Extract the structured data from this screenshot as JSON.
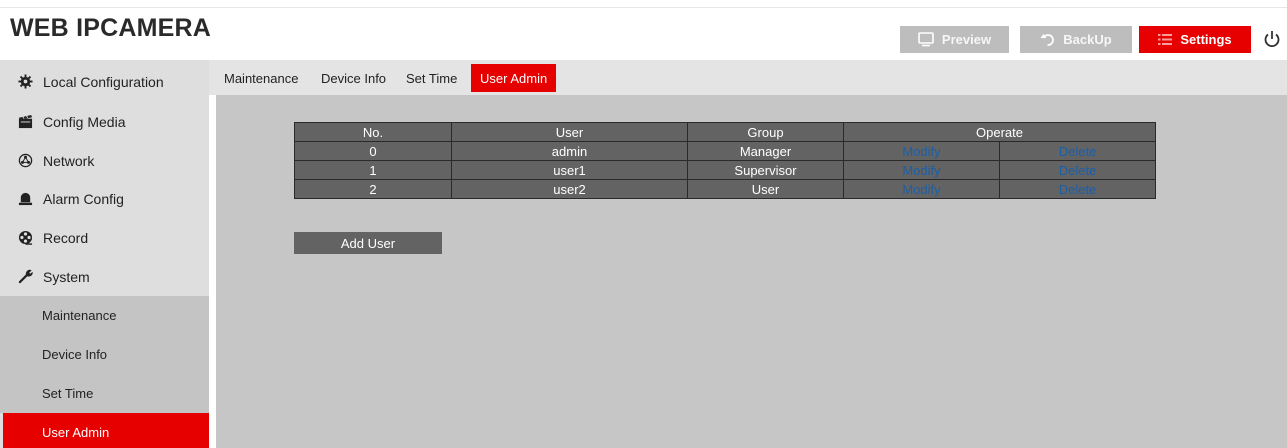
{
  "header": {
    "brand": "WEB IPCAMERA",
    "buttons": {
      "preview": "Preview",
      "backup": "BackUp",
      "settings": "Settings"
    },
    "icons": {
      "preview": "monitor-icon",
      "backup": "undo-icon",
      "settings": "list-icon",
      "power": "power-icon"
    }
  },
  "sidebar": {
    "items": [
      {
        "label": "Local Configuration",
        "icon": "gear-icon"
      },
      {
        "label": "Config Media",
        "icon": "media-icon"
      },
      {
        "label": "Network",
        "icon": "network-icon"
      },
      {
        "label": "Alarm Config",
        "icon": "alarm-icon"
      },
      {
        "label": "Record",
        "icon": "record-icon"
      },
      {
        "label": "System",
        "icon": "wrench-icon"
      }
    ],
    "subitems": [
      {
        "label": "Maintenance"
      },
      {
        "label": "Device Info"
      },
      {
        "label": "Set Time"
      },
      {
        "label": "User Admin",
        "active": true
      }
    ]
  },
  "tabs": [
    {
      "label": "Maintenance"
    },
    {
      "label": "Device Info"
    },
    {
      "label": "Set Time"
    },
    {
      "label": "User Admin",
      "active": true
    }
  ],
  "table": {
    "headers": {
      "no": "No.",
      "user": "User",
      "group": "Group",
      "operate": "Operate"
    },
    "rows": [
      {
        "no": "0",
        "user": "admin",
        "group": "Manager",
        "modify": "Modify",
        "delete": "Delete"
      },
      {
        "no": "1",
        "user": "user1",
        "group": "Supervisor",
        "modify": "Modify",
        "delete": "Delete"
      },
      {
        "no": "2",
        "user": "user2",
        "group": "User",
        "modify": "Modify",
        "delete": "Delete"
      }
    ]
  },
  "add_user_label": "Add User",
  "colors": {
    "accent": "#e60000",
    "table_bg": "#636363",
    "link": "#1b5fa8",
    "content_bg": "#c6c6c6"
  }
}
